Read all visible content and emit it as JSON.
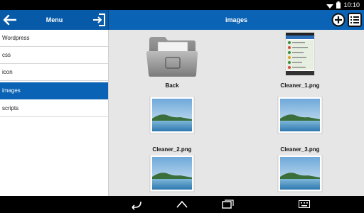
{
  "status_bar": {
    "time": "10:10"
  },
  "sidebar_header": {
    "title": "Menu"
  },
  "main_header": {
    "title": "images"
  },
  "sidebar": {
    "items": [
      {
        "label": "Wordpress",
        "selected": false
      },
      {
        "label": "css",
        "selected": false
      },
      {
        "label": "icon",
        "selected": false
      },
      {
        "label": "images",
        "selected": true
      },
      {
        "label": "scripts",
        "selected": false
      }
    ]
  },
  "files": [
    {
      "name": "Back",
      "kind": "folder-icon"
    },
    {
      "name": "Cleaner_1.png",
      "kind": "screenshot-thumbnail"
    },
    {
      "name": "Cleaner_2.png",
      "kind": "landscape-thumbnail"
    },
    {
      "name": "Cleaner_3.png",
      "kind": "landscape-thumbnail"
    },
    {
      "name": "",
      "kind": "landscape-thumbnail"
    },
    {
      "name": "",
      "kind": "landscape-thumbnail"
    }
  ],
  "colors": {
    "accent": "#0a63b4",
    "panel_bg": "#e6e6e6",
    "sidebar_bg": "#ffffff"
  }
}
